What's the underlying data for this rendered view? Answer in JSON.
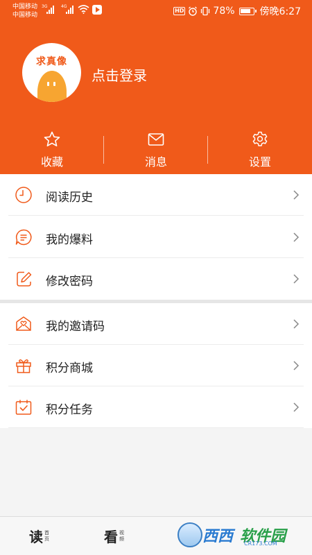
{
  "status_bar": {
    "carrier_1": "中国移动",
    "carrier_2": "中国移动",
    "net_1": "3G",
    "net_2": "4G",
    "hd": "HD",
    "battery": "78%",
    "time": "傍晚6:27"
  },
  "profile": {
    "avatar_text": "求真像",
    "login_label": "点击登录"
  },
  "actions": [
    {
      "label": "收藏",
      "icon": "star-icon"
    },
    {
      "label": "消息",
      "icon": "mail-icon"
    },
    {
      "label": "设置",
      "icon": "gear-icon"
    }
  ],
  "menu_group_1": [
    {
      "label": "阅读历史",
      "icon": "clock-icon"
    },
    {
      "label": "我的爆料",
      "icon": "chat-bubble-icon"
    },
    {
      "label": "修改密码",
      "icon": "edit-icon"
    }
  ],
  "menu_group_2": [
    {
      "label": "我的邀请码",
      "icon": "invite-icon"
    },
    {
      "label": "积分商城",
      "icon": "gift-icon"
    },
    {
      "label": "积分任务",
      "icon": "calendar-check-icon"
    }
  ],
  "tabbar": {
    "read_big": "读",
    "read_small": "首页",
    "watch_big": "看",
    "watch_small": "视频"
  },
  "watermark": {
    "text_1": "西西",
    "text_2": "软件园",
    "url": "CR173.COM"
  },
  "colors": {
    "accent": "#f05a1a",
    "background": "#f4f4f4"
  }
}
